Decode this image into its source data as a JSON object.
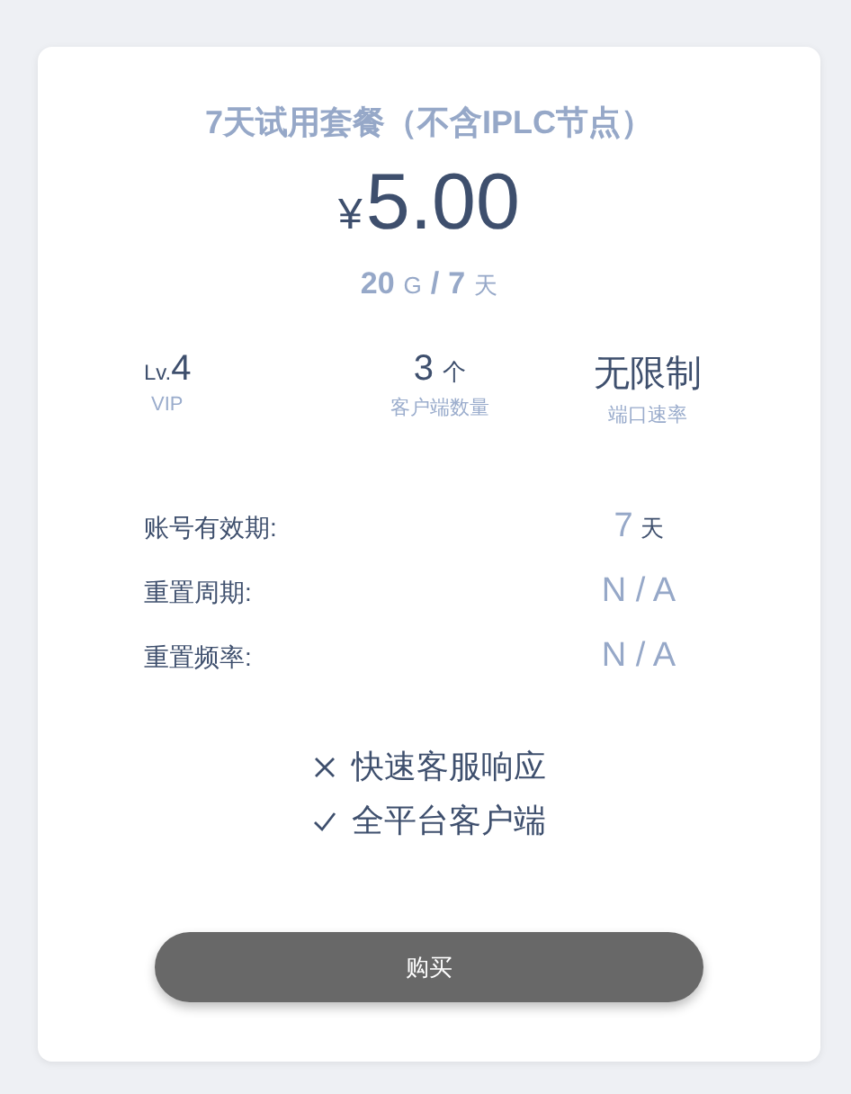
{
  "plan": {
    "title": "7天试用套餐（不含IPLC节点）",
    "currency": "¥",
    "price": "5.00",
    "quota": {
      "traffic": "20",
      "traffic_unit": "G",
      "separator": "/",
      "days": "7",
      "days_unit": "天"
    }
  },
  "stats": [
    {
      "prefix": "Lv.",
      "value": "4",
      "label": "VIP"
    },
    {
      "value": "3",
      "unit": "个",
      "label": "客户端数量"
    },
    {
      "value": "无限制",
      "label": "端口速率"
    }
  ],
  "details": [
    {
      "label": "账号有效期:",
      "value": "7",
      "unit": "天"
    },
    {
      "label": "重置周期:",
      "value": "N / A"
    },
    {
      "label": "重置频率:",
      "value": "N / A"
    }
  ],
  "features": [
    {
      "text": "快速客服响应",
      "included": false
    },
    {
      "text": "全平台客户端",
      "included": true
    }
  ],
  "buy_button": "购买"
}
